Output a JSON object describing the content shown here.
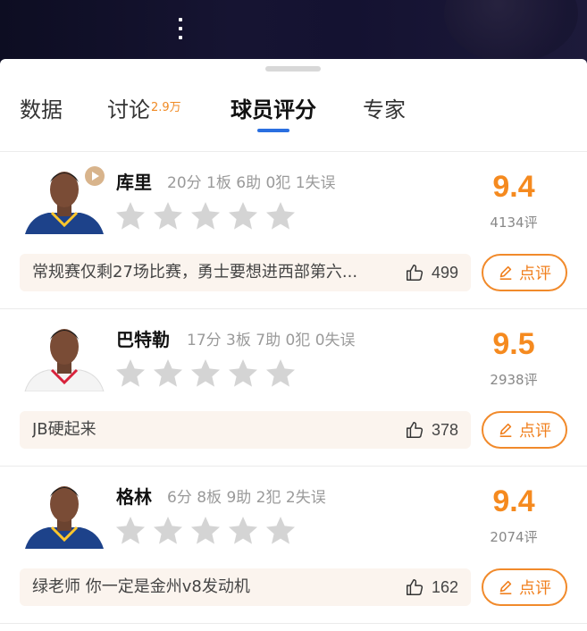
{
  "tabs": [
    {
      "label": "数据",
      "badge": ""
    },
    {
      "label": "讨论",
      "badge": "2.9万"
    },
    {
      "label": "球员评分",
      "badge": ""
    },
    {
      "label": "专家",
      "badge": ""
    }
  ],
  "active_tab": "球员评分",
  "colors": {
    "accent_orange": "#f58a1f",
    "tab_underline": "#2a6fe0",
    "comment_bg": "#fbf4ee",
    "star_empty": "#d4d4d4"
  },
  "players": [
    {
      "name": "库里",
      "stats": "20分 1板 6助 0犯 1失误",
      "score": "9.4",
      "rating_count": "4134评",
      "stars_filled": 0,
      "comment": "常规赛仅剩27场比赛，勇士要想进西部第六...",
      "likes": "499",
      "review_label": "点评",
      "has_video": true,
      "jersey_color": "#1d428a"
    },
    {
      "name": "巴特勒",
      "stats": "17分 3板 7助 0犯 0失误",
      "score": "9.5",
      "rating_count": "2938评",
      "stars_filled": 0,
      "comment": "JB硬起来",
      "likes": "378",
      "review_label": "点评",
      "has_video": false,
      "jersey_color": "#f4f4f4"
    },
    {
      "name": "格林",
      "stats": "6分 8板 9助 2犯 2失误",
      "score": "9.4",
      "rating_count": "2074评",
      "stars_filled": 0,
      "comment": "绿老师  你一定是金州v8发动机",
      "likes": "162",
      "review_label": "点评",
      "has_video": false,
      "jersey_color": "#1d428a"
    }
  ],
  "icons": {
    "more": "more-vertical-icon",
    "play": "play-icon",
    "star": "star-icon",
    "like": "thumbs-up-icon",
    "edit": "pencil-icon"
  }
}
